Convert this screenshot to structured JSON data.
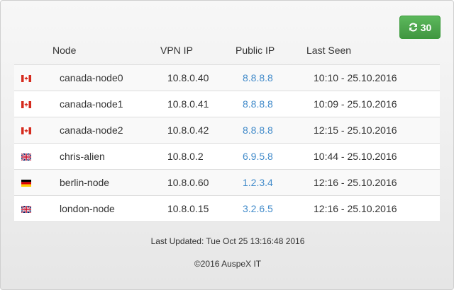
{
  "refresh_button": {
    "icon": "refresh-icon",
    "count": "30",
    "color": "#5cb85c"
  },
  "table": {
    "headers": {
      "node": "Node",
      "vpn_ip": "VPN IP",
      "public_ip": "Public IP",
      "last_seen": "Last Seen"
    },
    "rows": [
      {
        "flag": "canada-flag-icon",
        "node": "canada-node0",
        "vpn_ip": "10.8.0.40",
        "public_ip": "8.8.8.8",
        "last_seen": "10:10 - 25.10.2016"
      },
      {
        "flag": "canada-flag-icon",
        "node": "canada-node1",
        "vpn_ip": "10.8.0.41",
        "public_ip": "8.8.8.8",
        "last_seen": "10:09 - 25.10.2016"
      },
      {
        "flag": "canada-flag-icon",
        "node": "canada-node2",
        "vpn_ip": "10.8.0.42",
        "public_ip": "8.8.8.8",
        "last_seen": "12:15 - 25.10.2016"
      },
      {
        "flag": "uk-flag-icon",
        "node": "chris-alien",
        "vpn_ip": "10.8.0.2",
        "public_ip": "6.9.5.8",
        "last_seen": "10:44 - 25.10.2016"
      },
      {
        "flag": "germany-flag-icon",
        "node": "berlin-node",
        "vpn_ip": "10.8.0.60",
        "public_ip": "1.2.3.4",
        "last_seen": "12:16 - 25.10.2016"
      },
      {
        "flag": "uk-flag-icon",
        "node": "london-node",
        "vpn_ip": "10.8.0.15",
        "public_ip": "3.2.6.5",
        "last_seen": "12:16 - 25.10.2016"
      }
    ],
    "link_color": "#428bca"
  },
  "footer": {
    "last_updated": "Last Updated: Tue Oct 25 13:16:48 2016",
    "copyright": "©2016 AuspeX IT"
  }
}
